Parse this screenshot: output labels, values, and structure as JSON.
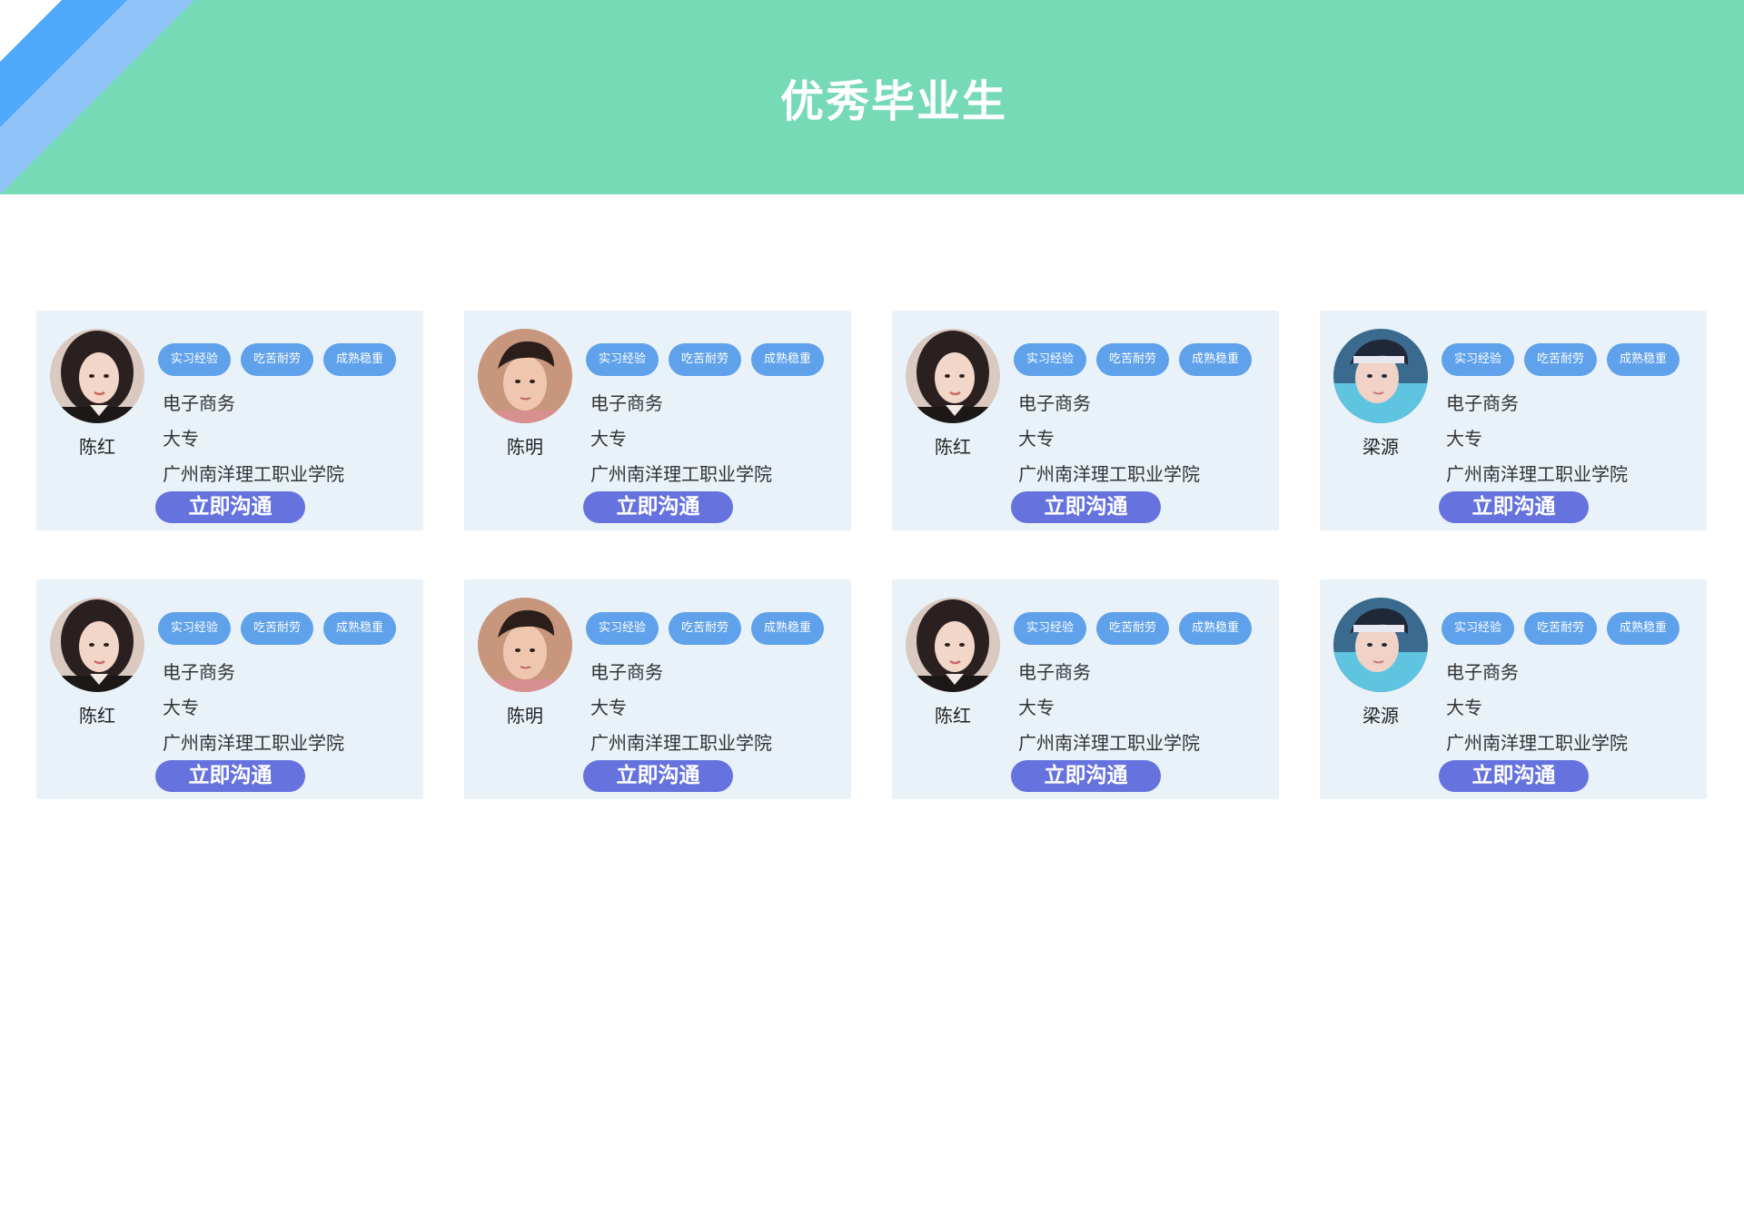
{
  "header": {
    "title": "优秀毕业生",
    "background_color": "#76dab7",
    "corner_stripe_colors": [
      "#4ea8fb",
      "#8fc3f8"
    ]
  },
  "card_common": {
    "tags": [
      "实习经验",
      "吃苦耐劳",
      "成熟稳重"
    ],
    "button_label": "立即沟通",
    "tag_color": "#5fa1ea",
    "button_color": "#6673df",
    "card_background": "#e9f2f8"
  },
  "cards": [
    {
      "name": "陈红",
      "major": "电子商务",
      "degree": "大专",
      "school": "广州南洋理工职业学院",
      "avatar": "female-portrait-icon"
    },
    {
      "name": "陈明",
      "major": "电子商务",
      "degree": "大专",
      "school": "广州南洋理工职业学院",
      "avatar": "male-portrait-icon"
    },
    {
      "name": "陈红",
      "major": "电子商务",
      "degree": "大专",
      "school": "广州南洋理工职业学院",
      "avatar": "female-portrait-icon"
    },
    {
      "name": "梁源",
      "major": "电子商务",
      "degree": "大专",
      "school": "广州南洋理工职业学院",
      "avatar": "male-portrait-blue-icon"
    },
    {
      "name": "陈红",
      "major": "电子商务",
      "degree": "大专",
      "school": "广州南洋理工职业学院",
      "avatar": "female-portrait-icon"
    },
    {
      "name": "陈明",
      "major": "电子商务",
      "degree": "大专",
      "school": "广州南洋理工职业学院",
      "avatar": "male-portrait-icon"
    },
    {
      "name": "陈红",
      "major": "电子商务",
      "degree": "大专",
      "school": "广州南洋理工职业学院",
      "avatar": "female-portrait-icon"
    },
    {
      "name": "梁源",
      "major": "电子商务",
      "degree": "大专",
      "school": "广州南洋理工职业学院",
      "avatar": "male-portrait-blue-icon"
    }
  ]
}
